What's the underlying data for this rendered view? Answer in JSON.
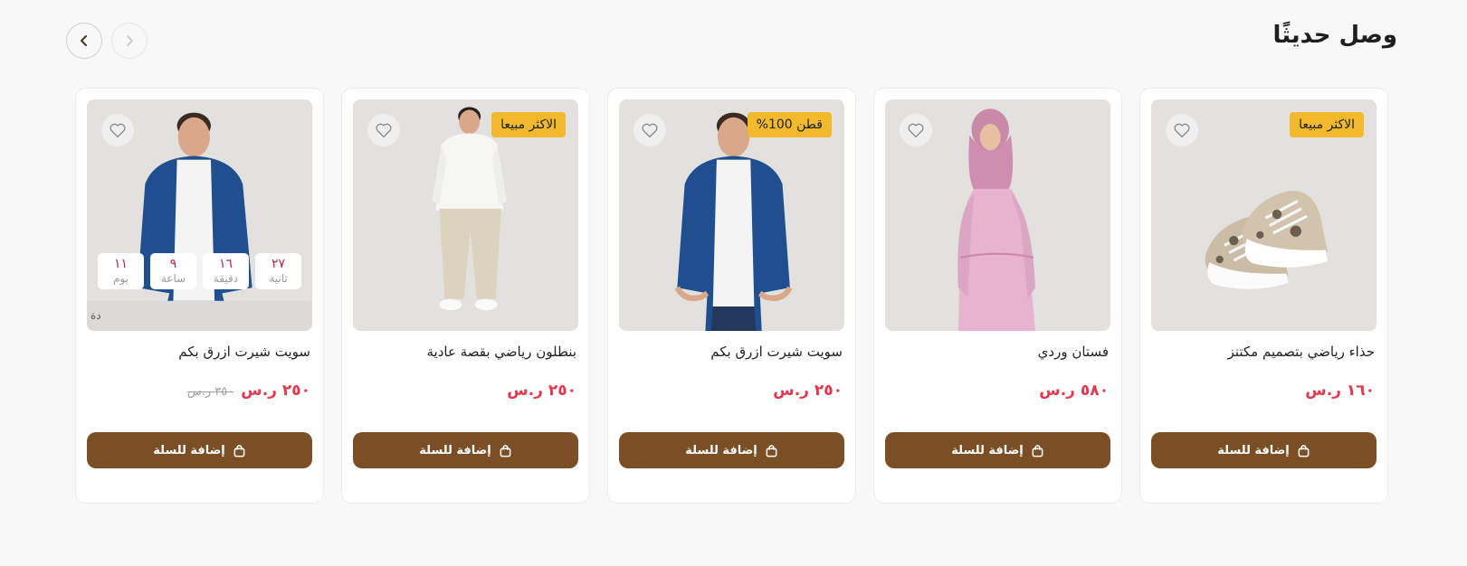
{
  "section": {
    "title": "وصل حديثًا",
    "next_icon": "chevron-left-icon",
    "prev_icon": "chevron-right-icon"
  },
  "colors": {
    "badge": "#f1b92b",
    "price": "#e0394f",
    "button": "#7a4f25",
    "countdown_number": "#b3274f"
  },
  "products": [
    {
      "name": "حذاء رياضي بتصميم مكتنز",
      "price": "١٦٠ ر.س",
      "badge": "الاكثر مبيعا",
      "add_label": "إضافة للسلة",
      "image": "sneakers-image"
    },
    {
      "name": "فستان وردي",
      "price": "٥٨٠ ر.س",
      "add_label": "إضافة للسلة",
      "image": "pink-dress-image"
    },
    {
      "name": "سويت شيرت ازرق بكم",
      "price": "٢٥٠ ر.س",
      "badge": "قطن 100%",
      "add_label": "إضافة للسلة",
      "image": "blue-sweater-image"
    },
    {
      "name": "بنطلون رياضي بقصة عادية",
      "price": "٢٥٠ ر.س",
      "badge": "الاكثر مبيعا",
      "add_label": "إضافة للسلة",
      "image": "sweatpants-image"
    },
    {
      "name": "سويت شيرت ازرق بكم",
      "price": "٢٥٠ ر.س",
      "old_price": "٣٥٠ ر.س",
      "add_label": "إضافة للسلة",
      "image": "blue-sweater-image",
      "countdown": {
        "days": "١١",
        "days_label": "يوم",
        "hours": "٩",
        "hours_label": "ساعة",
        "minutes": "١٦",
        "minutes_label": "دقيقة",
        "seconds": "٢٧",
        "seconds_label": "ثانية",
        "caption": "دة"
      }
    }
  ]
}
